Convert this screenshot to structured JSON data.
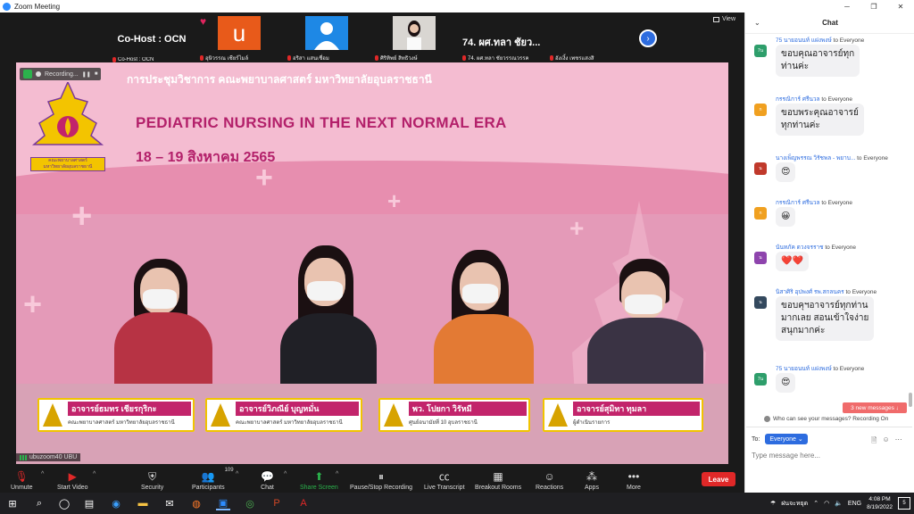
{
  "window": {
    "title": "Zoom Meeting",
    "controls": {
      "min": "─",
      "restore": "❐",
      "close": "✕"
    }
  },
  "strip": {
    "view_label": "View",
    "tiles": [
      {
        "big": "Co-Host : OCN",
        "name": "Co-Host : OCN"
      },
      {
        "name": "อุษิวรรณ เชียร์ไมล์",
        "avatar_letter": "u"
      },
      {
        "name": "อริสา แสนเชื่อม"
      },
      {
        "name": "ศิริทิพย์ สิทธิวงษ์"
      },
      {
        "big": "74. ผศ.ทลา ชัยว...",
        "name": "74. ผศ.ทลา ชัยวรรณวรรค"
      },
      {
        "name": "อังเงิ้ง เพชรแสงสิ"
      }
    ]
  },
  "screen": {
    "recording_label": "Recording...",
    "thai_header": "การประชุมวิชาการ คณะพยาบาลศาสตร์ มหาวิทยาลัยอุบลราชธานี",
    "main_title": "PEDIATRIC NURSING IN THE NEXT NORMAL ERA",
    "date_title": "18 – 19 สิงหาคม 2565",
    "logo_caption_1": "คณะพยาบาลศาสตร์",
    "logo_caption_2": "มหาวิทยาลัยอุบลราชธานี",
    "plaques": [
      {
        "name": "อาจารย์ธมทร เชียรกุริกะ",
        "sub": "คณะพยาบาลศาสตร์ มหาวิทยาลัยอุบลราชธานี"
      },
      {
        "name": "อาจารย์วิภณีย์ บุญหมั่น",
        "sub": "คณะพยาบาลศาสตร์ มหาวิทยาลัยอุบลราชธานี"
      },
      {
        "name": "พว. โปยกา วิรัหมี",
        "sub": "ศูนย์อนามัยที่ 10 อุบลราชธานี"
      },
      {
        "name": "อาจารย์สุมิทา ทุมลา",
        "sub": "ผู้ดำเนินรายการ"
      }
    ],
    "sharer": "ubuzoom40 UBU"
  },
  "toolbar": {
    "unmute": "Unmute",
    "start_video": "Start Video",
    "security": "Security",
    "participants": "Participants",
    "participants_count": "109",
    "chat": "Chat",
    "share_screen": "Share Screen",
    "pause_recording": "Pause/Stop Recording",
    "live_transcript": "Live Transcript",
    "breakout_rooms": "Breakout Rooms",
    "reactions": "Reactions",
    "apps": "Apps",
    "more": "More",
    "leave": "Leave"
  },
  "chat": {
    "title": "Chat",
    "messages": [
      {
        "from": "75 นายอนนท์ แฝงพงษ์",
        "to": "to Everyone",
        "text1": "ขอบคุณอาจารย์ทุก",
        "text2": "ท่านค่ะ",
        "av": "7น",
        "color": "#2e9e6b"
      },
      {
        "from": "กรรณิการ์ ศรีนวล",
        "to": "to Everyone",
        "text1": "ขอบพระคุณอาจารย์",
        "text2": "ทุกท่านค่ะ",
        "av": "ก",
        "color": "#f0a020"
      },
      {
        "from": "นางเพ็ญพรรณ วิรัชพล - พยาบ...",
        "to": "to Everyone",
        "text1": "😍",
        "av": "น",
        "color": "#c0392b"
      },
      {
        "from": "กรรณิการ์ ศรีนวล",
        "to": "to Everyone",
        "text1": "😀",
        "av": "ก",
        "color": "#f0a020"
      },
      {
        "from": "นันทภัค ดวงจรราช",
        "to": "to Everyone",
        "text1": "❤️❤️",
        "av": "น",
        "color": "#8e44ad"
      },
      {
        "from": "นิสาศิริ อุปพงศ์ รพ.สกลนคร",
        "to": "to Everyone",
        "text1": "ขอบคุฯอาจารย์ทุกท่าน",
        "text2": "มากเลย สอนเข้าใจง่าย",
        "text3": "สนุกมากค่ะ",
        "av": "น",
        "color": "#34495e"
      },
      {
        "from": "75 นายอนนท์ แฝงพงษ์",
        "to": "to Everyone",
        "text1": "😍",
        "av": "7น",
        "color": "#2e9e6b"
      }
    ],
    "new_messages": "3 new messages ↓",
    "who_can_see": "Who can see your messages? Recording On",
    "to_label": "To:",
    "to_value": "Everyone",
    "placeholder": "Type message here..."
  },
  "taskbar": {
    "lang": "ENG",
    "time": "4:08 PM",
    "date": "8/19/2022",
    "thai_status": "ฝนจะหยุด",
    "notif_count": "5"
  }
}
